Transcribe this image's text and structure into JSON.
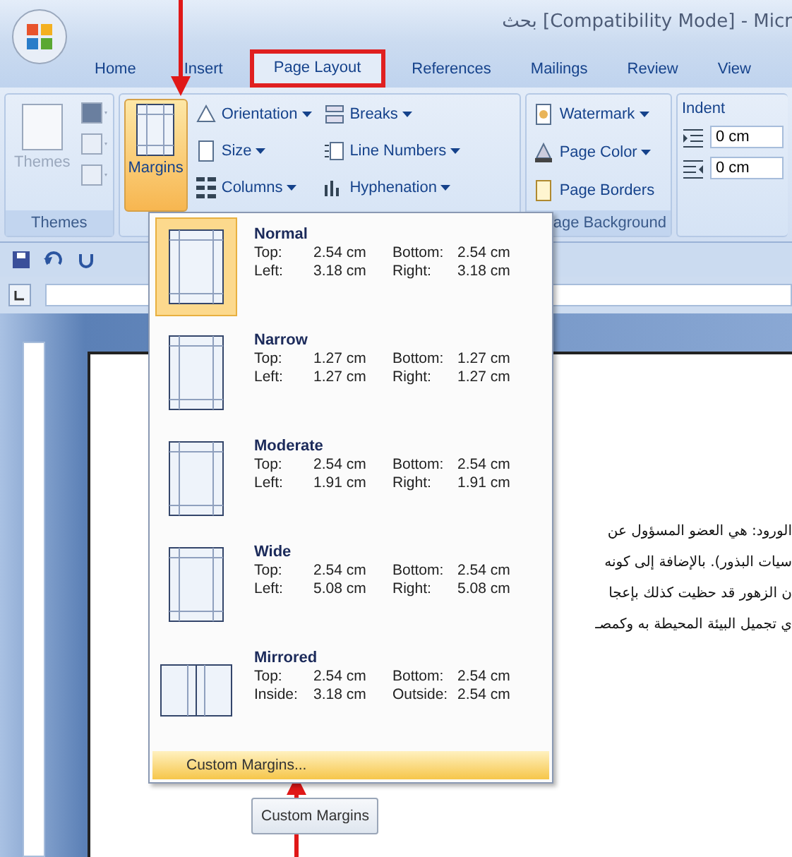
{
  "window": {
    "title": "بحث [Compatibility Mode] - Micr"
  },
  "tabs": [
    {
      "label": "Home",
      "selected": false,
      "outlined": false
    },
    {
      "label": "Insert",
      "selected": false,
      "outlined": false
    },
    {
      "label": "Page Layout",
      "selected": true,
      "outlined": true
    },
    {
      "label": "References",
      "selected": false,
      "outlined": false
    },
    {
      "label": "Mailings",
      "selected": false,
      "outlined": false
    },
    {
      "label": "Review",
      "selected": false,
      "outlined": false
    },
    {
      "label": "View",
      "selected": false,
      "outlined": false
    }
  ],
  "themes_group": {
    "button": "Themes",
    "disabled": true,
    "label": "Themes"
  },
  "page_setup": {
    "margins_button": "Margins",
    "pressed": true,
    "commands": [
      {
        "kind": "orientation",
        "label": "Orientation"
      },
      {
        "kind": "breaks",
        "label": "Breaks"
      },
      {
        "kind": "size",
        "label": "Size"
      },
      {
        "kind": "line-numbers",
        "label": "Line Numbers"
      },
      {
        "kind": "columns",
        "label": "Columns"
      },
      {
        "kind": "hyphenation",
        "label": "Hyphenation"
      }
    ]
  },
  "page_background": {
    "label": "age Background",
    "commands": [
      {
        "kind": "watermark",
        "label": "Watermark"
      },
      {
        "kind": "page-color",
        "label": "Page Color"
      },
      {
        "kind": "page-borders",
        "label": "Page Borders"
      }
    ]
  },
  "paragraph": {
    "indent_label": "Indent",
    "fields": [
      {
        "kind": "left",
        "value": "0 cm"
      },
      {
        "kind": "right",
        "value": "0 cm"
      }
    ]
  },
  "margins_menu": {
    "items": [
      {
        "name": "Normal",
        "kind": "single",
        "selected": true,
        "values": [
          {
            "label": "Top:",
            "value": "2.54 cm"
          },
          {
            "label": "Bottom:",
            "value": "2.54 cm"
          },
          {
            "label": "Left:",
            "value": "3.18 cm"
          },
          {
            "label": "Right:",
            "value": "3.18 cm"
          }
        ]
      },
      {
        "name": "Narrow",
        "kind": "single",
        "selected": false,
        "values": [
          {
            "label": "Top:",
            "value": "1.27 cm"
          },
          {
            "label": "Bottom:",
            "value": "1.27 cm"
          },
          {
            "label": "Left:",
            "value": "1.27 cm"
          },
          {
            "label": "Right:",
            "value": "1.27 cm"
          }
        ]
      },
      {
        "name": "Moderate",
        "kind": "single",
        "selected": false,
        "values": [
          {
            "label": "Top:",
            "value": "2.54 cm"
          },
          {
            "label": "Bottom:",
            "value": "2.54 cm"
          },
          {
            "label": "Left:",
            "value": "1.91 cm"
          },
          {
            "label": "Right:",
            "value": "1.91 cm"
          }
        ]
      },
      {
        "name": "Wide",
        "kind": "single",
        "selected": false,
        "values": [
          {
            "label": "Top:",
            "value": "2.54 cm"
          },
          {
            "label": "Bottom:",
            "value": "2.54 cm"
          },
          {
            "label": "Left:",
            "value": "5.08 cm"
          },
          {
            "label": "Right:",
            "value": "5.08 cm"
          }
        ]
      },
      {
        "name": "Mirrored",
        "kind": "mirrored",
        "selected": false,
        "values": [
          {
            "label": "Top:",
            "value": "2.54 cm"
          },
          {
            "label": "Bottom:",
            "value": "2.54 cm"
          },
          {
            "label": "Inside:",
            "value": "3.18 cm"
          },
          {
            "label": "Outside:",
            "value": "2.54 cm"
          }
        ]
      }
    ],
    "footer": {
      "label": "Custom Margins...",
      "highlighted": true
    },
    "tooltip": "Custom Margins"
  },
  "document": {
    "lines": [
      "الورود: هي العضو المسؤول عن",
      "سيات البذور). بالإضافة إلى كونه",
      "ن الزهور قد حظيت كذلك بإعجا",
      "ي تجميل البيئة المحيطة به وكمصـ"
    ]
  }
}
